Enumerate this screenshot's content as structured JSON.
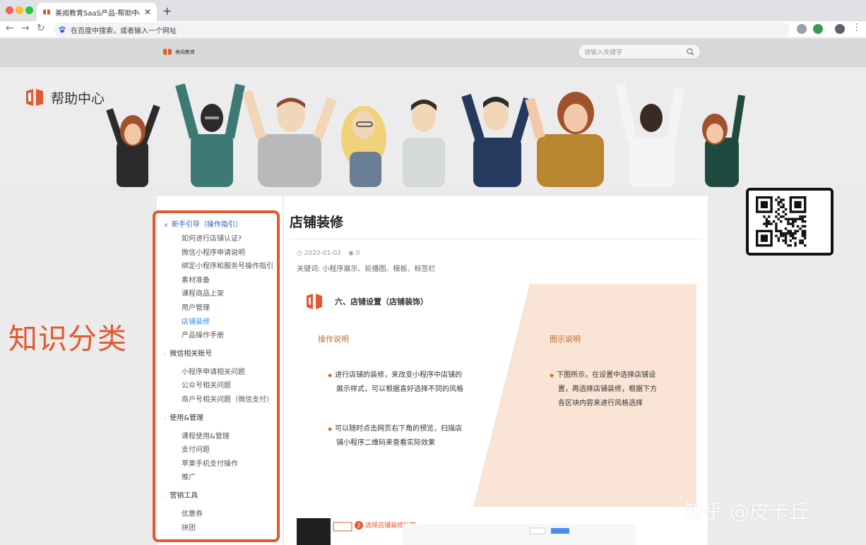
{
  "browser": {
    "tab_title": "美阅教育SaaS产品-帮助中心 | 店",
    "omnibox_placeholder": "在百度中搜索，或者输入一个网址"
  },
  "site": {
    "logo_text": "美阅教育",
    "search_placeholder": "请输入关键字",
    "help_title": "帮助中心"
  },
  "sidebar": {
    "groups": [
      {
        "label": "新手引导（操作指引）",
        "expanded": true,
        "items": [
          "如何进行店铺认证?",
          "微信小程序申请说明",
          "绑定小程序和服务号操作指引",
          "素材准备",
          "课程商品上架",
          "用户管理",
          "店铺装修",
          "产品操作手册"
        ],
        "active_item": "店铺装修"
      },
      {
        "label": "微信相关账号",
        "expanded": false,
        "items": [
          "小程序申请相关问题",
          "公众号相关问题",
          "商户号相关问题（微信支付）"
        ]
      },
      {
        "label": "使用&管理",
        "expanded": false,
        "items": [
          "课程使用&管理",
          "支付问题",
          "苹果手机支付操作",
          "推广"
        ]
      },
      {
        "label": "营销工具",
        "expanded": false,
        "items": [
          "优惠券",
          "拼团"
        ]
      }
    ]
  },
  "article": {
    "title": "店铺装修",
    "date": "2020-01-02",
    "views": "0",
    "keywords": "关键词: 小程序展示、轮播图、模板、标签栏",
    "section_title": "六、店铺设置（店铺装饰）",
    "op_label": "操作说明",
    "fig_label": "图示说明",
    "op_para1_l1": "进行店铺的装修，来改变小程序中店铺的",
    "op_para1_l2": "展示样式，可以根据喜好选择不同的风格",
    "op_para2_l1": "可以随时点击网页右下角的预览，扫描店",
    "op_para2_l2": "铺小程序二维码来查看实际效果",
    "fig_para_l1": "下图所示，在设置中选择店铺设",
    "fig_para_l2": "置，再选择店铺装修，根据下方",
    "fig_para_l3": "各区块内容来进行风格选择",
    "thumb_step_label": "选择店铺装修标签"
  },
  "annotation": {
    "category_label": "知识分类",
    "watermark": "知乎 @皮卡丘"
  },
  "colors": {
    "accent": "#e4582f",
    "link": "#2d8cf0",
    "peach": "#f9e4d6"
  }
}
